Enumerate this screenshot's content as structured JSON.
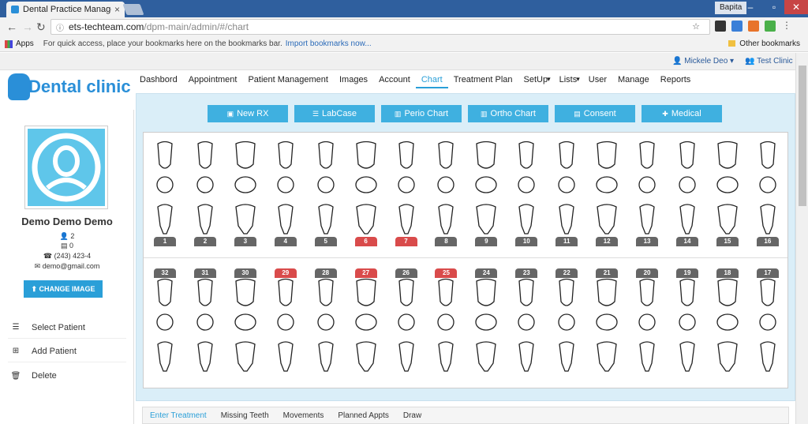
{
  "browser": {
    "tab_title": "Dental Practice Managen",
    "user_badge": "Bapita",
    "url_host": "ets-techteam.com",
    "url_path": "/dpm-main/admin/#/chart",
    "bookmarks_apps": "Apps",
    "bookmarks_hint": "For quick access, place your bookmarks here on the bookmarks bar.",
    "bookmarks_import": "Import bookmarks now...",
    "bookmarks_other": "Other bookmarks"
  },
  "header": {
    "user": "Mickele Deo",
    "clinic": "Test Clinic",
    "logo_text": "Dental clinic"
  },
  "nav": {
    "items": [
      "Dashbord",
      "Appointment",
      "Patient Management",
      "Images",
      "Account",
      "Chart",
      "Treatment Plan",
      "SetUp",
      "Lists",
      "User",
      "Manage",
      "Reports"
    ],
    "active": "Chart"
  },
  "patient": {
    "name": "Demo Demo Demo",
    "count_a": "2",
    "count_b": "0",
    "phone": "(243) 423-4",
    "email": "demo@gmail.com",
    "change_image": "CHANGE IMAGE"
  },
  "sidebar_menu": {
    "select": "Select Patient",
    "add": "Add Patient",
    "delete": "Delete"
  },
  "toolbar": {
    "new_rx": "New RX",
    "labcase": "LabCase",
    "perio": "Perio Chart",
    "ortho": "Ortho Chart",
    "consent": "Consent",
    "medical": "Medical"
  },
  "colors": {
    "accent": "#2a9fd8",
    "marked_tooth": "#d94b4b",
    "normal_tooth": "#666666"
  },
  "teeth": {
    "upper": [
      {
        "num": "1",
        "marked": false
      },
      {
        "num": "2",
        "marked": false
      },
      {
        "num": "3",
        "marked": false
      },
      {
        "num": "4",
        "marked": false
      },
      {
        "num": "5",
        "marked": false
      },
      {
        "num": "6",
        "marked": true
      },
      {
        "num": "7",
        "marked": true
      },
      {
        "num": "8",
        "marked": false
      },
      {
        "num": "9",
        "marked": false
      },
      {
        "num": "10",
        "marked": false
      },
      {
        "num": "11",
        "marked": false
      },
      {
        "num": "12",
        "marked": false
      },
      {
        "num": "13",
        "marked": false
      },
      {
        "num": "14",
        "marked": false
      },
      {
        "num": "15",
        "marked": false
      },
      {
        "num": "16",
        "marked": false
      }
    ],
    "lower": [
      {
        "num": "32",
        "marked": false
      },
      {
        "num": "31",
        "marked": false
      },
      {
        "num": "30",
        "marked": false
      },
      {
        "num": "29",
        "marked": true
      },
      {
        "num": "28",
        "marked": false
      },
      {
        "num": "27",
        "marked": true
      },
      {
        "num": "26",
        "marked": false
      },
      {
        "num": "25",
        "marked": true
      },
      {
        "num": "24",
        "marked": false
      },
      {
        "num": "23",
        "marked": false
      },
      {
        "num": "22",
        "marked": false
      },
      {
        "num": "21",
        "marked": false
      },
      {
        "num": "20",
        "marked": false
      },
      {
        "num": "19",
        "marked": false
      },
      {
        "num": "18",
        "marked": false
      },
      {
        "num": "17",
        "marked": false
      }
    ]
  },
  "bottom_tabs": {
    "items": [
      "Enter Treatment",
      "Missing Teeth",
      "Movements",
      "Planned Appts",
      "Draw"
    ],
    "active": "Enter Treatment"
  }
}
